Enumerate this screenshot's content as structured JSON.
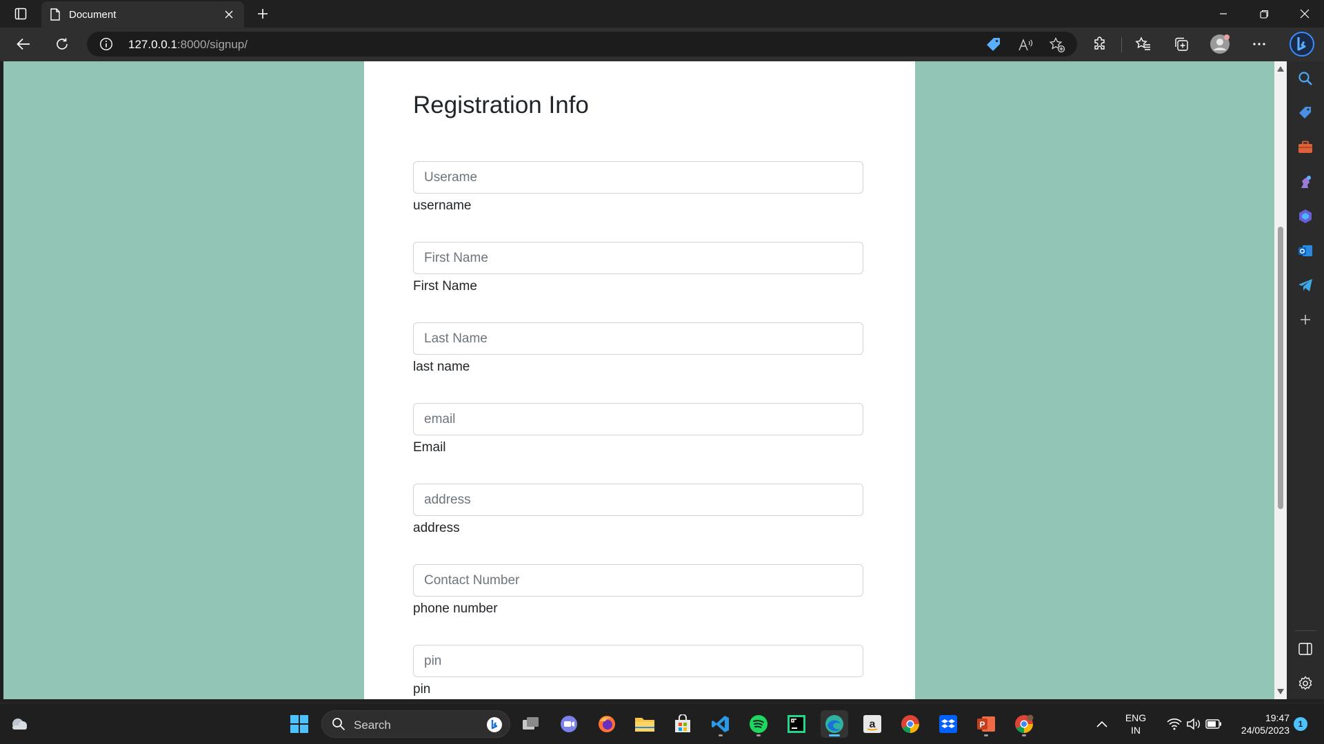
{
  "browser": {
    "tab_title": "Document",
    "url_host": "127.0.0.1",
    "url_rest": ":8000/signup/"
  },
  "page": {
    "heading": "Registration Info",
    "fields": [
      {
        "placeholder": "Userame",
        "label": "username"
      },
      {
        "placeholder": "First Name",
        "label": "First Name"
      },
      {
        "placeholder": "Last Name",
        "label": "last name"
      },
      {
        "placeholder": "email",
        "label": "Email"
      },
      {
        "placeholder": "address",
        "label": "address"
      },
      {
        "placeholder": "Contact Number",
        "label": "phone number"
      },
      {
        "placeholder": "pin",
        "label": "pin"
      }
    ],
    "colors": {
      "background": "#92c5b6",
      "card": "#ffffff"
    }
  },
  "taskbar": {
    "search_label": "Search",
    "language": "ENG",
    "region": "IN",
    "time": "19:47",
    "date": "24/05/2023",
    "notification_count": "1"
  },
  "icons": {
    "tabstrip": [
      "tab-actions-icon",
      "page-icon",
      "close-icon",
      "plus-icon",
      "minimize-icon",
      "restore-icon",
      "close-window-icon"
    ],
    "toolbar": [
      "back-arrow-icon",
      "refresh-icon",
      "info-icon",
      "coupon-tag-icon",
      "read-aloud-icon",
      "add-favorite-icon",
      "extensions-icon",
      "favorites-icon",
      "collections-icon",
      "profile-icon",
      "more-icon",
      "bing-icon"
    ],
    "sidebar": [
      "search-icon",
      "shopping-tag-icon",
      "tools-icon",
      "games-icon",
      "microsoft-365-icon",
      "outlook-icon",
      "telegram-icon",
      "add-icon",
      "split-screen-icon",
      "settings-icon"
    ]
  }
}
